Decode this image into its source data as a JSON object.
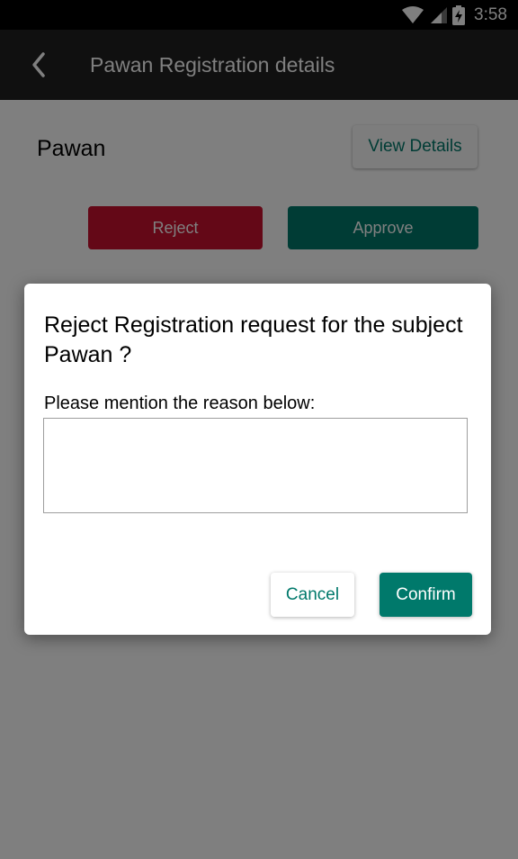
{
  "status_bar": {
    "time": "3:58"
  },
  "app_bar": {
    "title": "Pawan Registration details"
  },
  "details": {
    "subject_name": "Pawan",
    "view_details_label": "View Details",
    "reject_label": "Reject",
    "approve_label": "Approve"
  },
  "dialog": {
    "title": "Reject Registration request for the subject Pawan ?",
    "prompt": "Please mention the reason below:",
    "reason_value": "",
    "cancel_label": "Cancel",
    "confirm_label": "Confirm"
  },
  "colors": {
    "accent": "#00796b",
    "reject": "#c8102e",
    "app_bar": "#212121"
  }
}
